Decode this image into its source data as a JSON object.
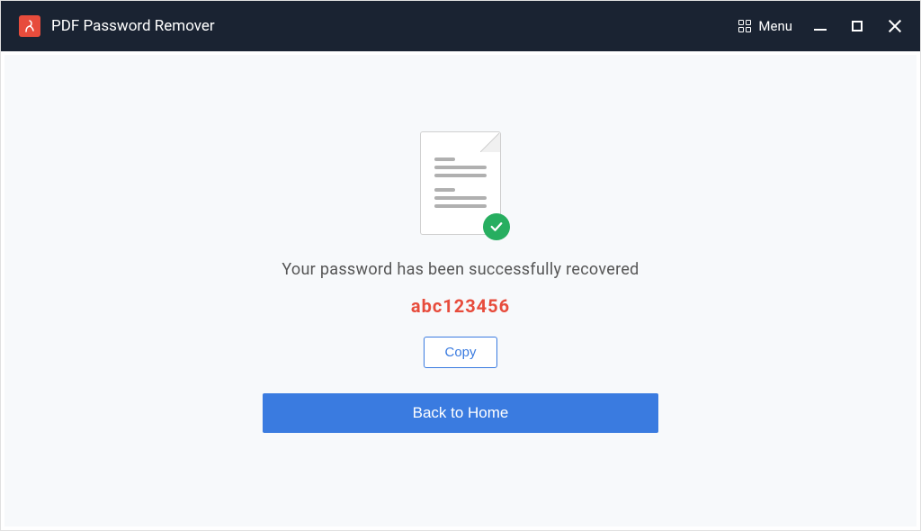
{
  "titlebar": {
    "app_title": "PDF Password Remover",
    "menu_label": "Menu"
  },
  "main": {
    "success_message": "Your password has been successfully recovered",
    "password_value": "abc123456",
    "copy_label": "Copy",
    "home_label": "Back to Home"
  },
  "colors": {
    "titlebar_bg": "#1a2332",
    "accent_red": "#e74c3c",
    "accent_blue": "#3a7be0",
    "success_green": "#27ae60",
    "content_bg": "#f7f9fb"
  }
}
